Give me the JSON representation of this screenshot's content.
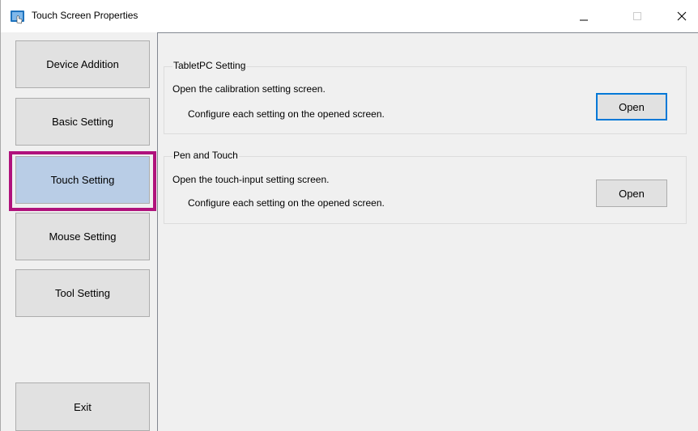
{
  "window": {
    "title": "Touch Screen Properties",
    "controls": {
      "minimize": "–",
      "maximize": "□",
      "close": "✕"
    }
  },
  "sidebar": {
    "items": [
      {
        "label": "Device Addition"
      },
      {
        "label": "Basic Setting"
      },
      {
        "label": "Touch Setting",
        "selected": true
      },
      {
        "label": "Mouse Setting"
      },
      {
        "label": "Tool Setting"
      }
    ],
    "exit_label": "Exit"
  },
  "content": {
    "groups": [
      {
        "title": "TabletPC Setting",
        "line1": "Open the calibration setting screen.",
        "line2": "Configure each setting on the opened screen.",
        "button": "Open"
      },
      {
        "title": "Pen and Touch",
        "line1": "Open the touch-input setting screen.",
        "line2": "Configure each setting on the opened screen.",
        "button": "Open"
      }
    ]
  },
  "colors": {
    "selected_item": "#b9cde6",
    "highlight_frame": "#b0127c",
    "focus_border": "#0078d7"
  }
}
